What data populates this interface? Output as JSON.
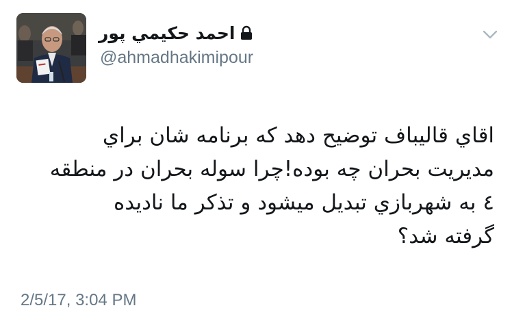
{
  "author": {
    "display_name": "احمد حكيمي پور",
    "handle": "@ahmadhakimipour",
    "protected": true,
    "avatar_icon": "avatar-photo"
  },
  "tweet": {
    "lines": [
      "اقاي قاليباف توضيح دهد كه برنامه شان براي",
      "مديريت بحران چه بوده!چرا سوله بحران در منطقه",
      "٤ به شهربازي تبديل ميشود و تذكر ما ناديده",
      "گرفته شد؟"
    ]
  },
  "timestamp": "2/5/17, 3:04 PM",
  "colors": {
    "text": "#14171a",
    "secondary": "#657786",
    "caret": "#aab8c2",
    "background": "#ffffff"
  },
  "icons": {
    "lock": "lock-icon",
    "caret": "chevron-down-icon"
  }
}
